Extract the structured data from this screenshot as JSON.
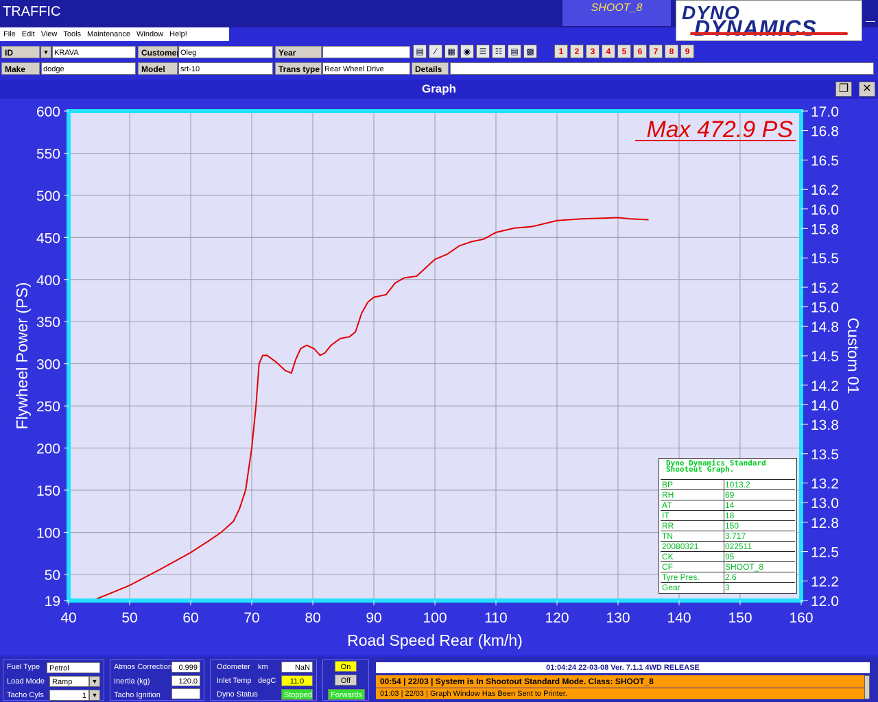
{
  "app": {
    "title": "TRAFFIC",
    "shoot_badge": "SHOOT_8",
    "logo_line1": "DYNO",
    "logo_line2": "DYNAMICS"
  },
  "menu": [
    "File",
    "Edit",
    "View",
    "Tools",
    "Maintenance",
    "Window",
    "Help!"
  ],
  "vehicle": {
    "id_label": "ID",
    "id_value": "KRAVA",
    "customer_label": "Customer",
    "customer_value": "Oleg",
    "year_label": "Year",
    "year_value": "",
    "make_label": "Make",
    "make_value": "dodge",
    "model_label": "Model",
    "model_value": "srt-10",
    "trans_label": "Trans type",
    "trans_value": "Rear Wheel Drive",
    "details_label": "Details",
    "details_value": ""
  },
  "toolbar_icons": [
    "bar-chart-icon",
    "line-graph-icon",
    "table-icon",
    "gauge-icon",
    "list-icon",
    "grid-icon",
    "printer-icon",
    "image-icon"
  ],
  "run_buttons": [
    "1",
    "2",
    "3",
    "4",
    "5",
    "6",
    "7",
    "8",
    "9"
  ],
  "graph_window": {
    "title": "Graph",
    "max_label": "Max 472.9 PS"
  },
  "chart_data": {
    "type": "line",
    "xlabel": "Road Speed Rear (km/h)",
    "ylabel": "Flywheel Power (PS)",
    "y2label": "Custom 01",
    "xlim": [
      40,
      160
    ],
    "ylim": [
      19,
      600
    ],
    "y2lim": [
      12.0,
      17.0
    ],
    "x_ticks": [
      "40",
      "50",
      "60",
      "70",
      "80",
      "90",
      "100",
      "110",
      "120",
      "130",
      "140",
      "150",
      "160"
    ],
    "y_ticks": [
      "19",
      "50",
      "100",
      "150",
      "200",
      "250",
      "300",
      "350",
      "400",
      "450",
      "500",
      "550",
      "600"
    ],
    "y2_ticks": [
      "12.0",
      "12.2",
      "12.5",
      "12.8",
      "13.0",
      "13.2",
      "13.5",
      "13.8",
      "14.0",
      "14.2",
      "14.5",
      "14.8",
      "15.0",
      "15.2",
      "15.5",
      "15.8",
      "16.0",
      "16.2",
      "16.5",
      "16.8",
      "17.0"
    ],
    "grid": true,
    "series": [
      {
        "color": "#e00000",
        "points": [
          [
            43.5,
            18
          ],
          [
            46,
            25
          ],
          [
            50,
            37
          ],
          [
            55,
            56
          ],
          [
            60,
            76
          ],
          [
            63,
            90
          ],
          [
            65,
            100
          ],
          [
            67,
            113
          ],
          [
            68,
            128
          ],
          [
            69,
            150
          ],
          [
            70,
            200
          ],
          [
            70.7,
            250
          ],
          [
            71.2,
            300
          ],
          [
            71.8,
            310
          ],
          [
            72.5,
            310
          ],
          [
            74,
            302
          ],
          [
            75.5,
            292
          ],
          [
            76.5,
            289
          ],
          [
            77.2,
            305
          ],
          [
            78,
            318
          ],
          [
            79,
            322
          ],
          [
            80.2,
            318
          ],
          [
            81.2,
            310
          ],
          [
            82,
            313
          ],
          [
            83,
            322
          ],
          [
            84.5,
            330
          ],
          [
            86,
            332
          ],
          [
            87,
            338
          ],
          [
            88,
            360
          ],
          [
            89,
            373
          ],
          [
            90,
            379
          ],
          [
            92,
            382
          ],
          [
            93.5,
            396
          ],
          [
            95,
            402
          ],
          [
            97,
            404
          ],
          [
            98.5,
            414
          ],
          [
            100,
            424
          ],
          [
            102,
            430
          ],
          [
            104,
            440
          ],
          [
            106,
            445
          ],
          [
            108,
            448
          ],
          [
            110,
            456
          ],
          [
            113,
            461
          ],
          [
            116,
            463
          ],
          [
            120,
            470
          ],
          [
            124,
            472
          ],
          [
            128,
            473
          ],
          [
            130,
            473.5
          ],
          [
            132,
            472
          ],
          [
            135,
            471
          ]
        ]
      }
    ]
  },
  "info_table": {
    "title_line1": "Dyno Dynamics Standard",
    "title_line2": "Shootout Graph.",
    "rows": [
      {
        "k": "BP",
        "v": "1013.2"
      },
      {
        "k": "RH",
        "v": "69"
      },
      {
        "k": "AT",
        "v": "14"
      },
      {
        "k": "IT",
        "v": "18"
      },
      {
        "k": "RR",
        "v": "150"
      },
      {
        "k": "TN",
        "v": "3.717"
      },
      {
        "k": "20080321",
        "v": "022511"
      },
      {
        "k": "CK",
        "v": "95"
      },
      {
        "k": "CF",
        "v": "SHOOT_8"
      },
      {
        "k": "Tyre Pres.",
        "v": "2.6"
      },
      {
        "k": "Gear",
        "v": "3"
      }
    ]
  },
  "bottom": {
    "fuel_type_label": "Fuel Type",
    "fuel_type_value": "Petrol",
    "load_mode_label": "Load Mode",
    "load_mode_value": "Ramp",
    "tacho_cyls_label": "Tacho Cyls",
    "tacho_cyls_value": "1",
    "atmos_label": "Atmos Correction",
    "atmos_value": "0.999",
    "inertia_label": "Inertia (kg)",
    "inertia_value": "120.0",
    "tacho_ign_label": "Tacho Ignition",
    "tacho_ign_value": "",
    "odometer_label": "Odometer",
    "odometer_unit": "km",
    "odometer_value": "NaN",
    "inlet_label": "Inlet Temp",
    "inlet_unit": "degC",
    "inlet_value": "11.0",
    "dyno_status_label": "Dyno Status",
    "dyno_status_value": "Stopped",
    "on_label": "On",
    "off_label": "Off",
    "forwards_label": "Forwards",
    "status_line": "01:04:24     22-03-08     Ver. 7.1.1  4WD RELEASE",
    "message1": "00:54 | 22/03 | System is In Shootout Standard Mode. Class: SHOOT_8",
    "message2": "01:03 | 22/03 | Graph Window Has Been Sent to Printer."
  }
}
